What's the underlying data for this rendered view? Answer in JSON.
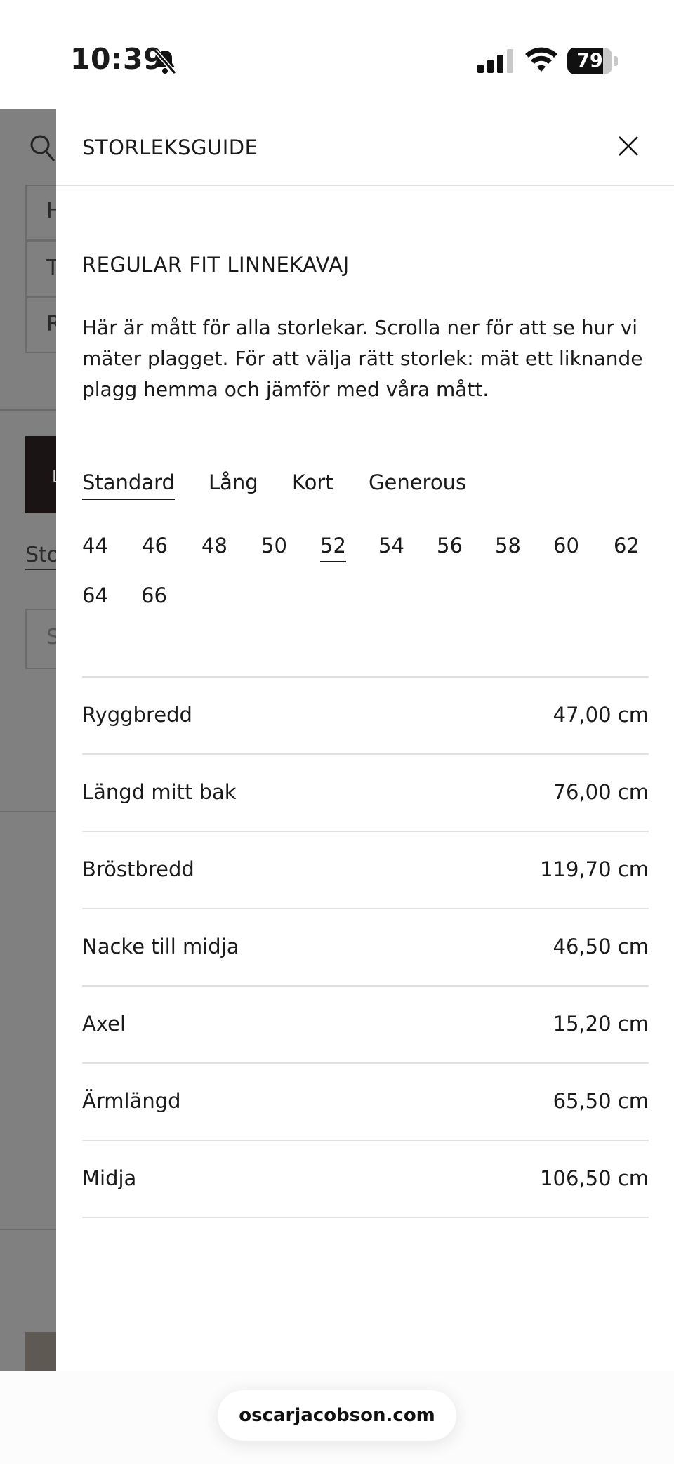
{
  "status_bar": {
    "time": "10:39",
    "battery_percent": "79",
    "battery_level": 0.79
  },
  "drawer": {
    "title": "STORLEKSGUIDE"
  },
  "product": {
    "title": "REGULAR FIT LINNEKAVAJ",
    "intro": "Här är mått för alla storlekar. Scrolla ner för att se hur vi mäter plagget. För att välja rätt storlek: mät ett liknande plagg hemma och jämför med våra mått."
  },
  "fit_tabs": [
    {
      "label": "Standard",
      "active": true
    },
    {
      "label": "Lång",
      "active": false
    },
    {
      "label": "Kort",
      "active": false
    },
    {
      "label": "Generous",
      "active": false
    }
  ],
  "sizes": [
    "44",
    "46",
    "48",
    "50",
    "52",
    "54",
    "56",
    "58",
    "60",
    "62",
    "64",
    "66"
  ],
  "selected_size": "52",
  "measurements": [
    {
      "label": "Ryggbredd",
      "value": "47,00 cm"
    },
    {
      "label": "Längd mitt bak",
      "value": "76,00 cm"
    },
    {
      "label": "Bröstbredd",
      "value": "119,70 cm"
    },
    {
      "label": "Nacke till midja",
      "value": "46,50 cm"
    },
    {
      "label": "Axel",
      "value": "15,20 cm"
    },
    {
      "label": "Ärmlängd",
      "value": "65,50 cm"
    },
    {
      "label": "Midja",
      "value": "106,50 cm"
    }
  ],
  "browser": {
    "url": "oscarjacobson.com"
  },
  "background_page": {
    "letters": [
      "H",
      "T",
      "R"
    ],
    "link_partial": "Sto",
    "field_partial": "S",
    "button_partial": "L"
  },
  "icons": {
    "search": "search-icon",
    "close": "close-icon",
    "bell_off": "bell-slash-icon",
    "signal": "cellular-signal-icon",
    "wifi": "wifi-icon",
    "battery": "battery-icon"
  }
}
